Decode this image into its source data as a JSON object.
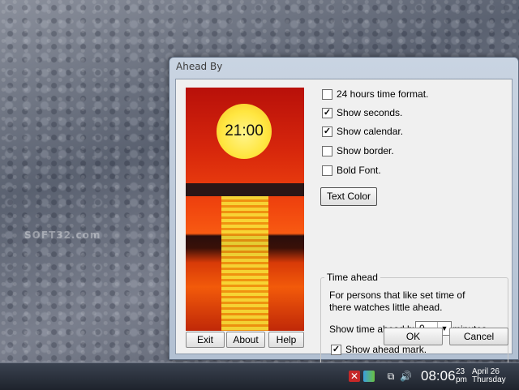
{
  "watermark": "SOFT32.com",
  "window": {
    "title": "Ahead By",
    "preview_time": "21:00",
    "options": [
      {
        "label": "24 hours time format.",
        "checked": false
      },
      {
        "label": "Show seconds.",
        "checked": true
      },
      {
        "label": "Show calendar.",
        "checked": true
      },
      {
        "label": "Show border.",
        "checked": false
      },
      {
        "label": "Bold Font.",
        "checked": false
      }
    ],
    "text_color_button": "Text Color",
    "time_ahead": {
      "group_title": "Time ahead",
      "description_line1": "For persons that like set time of",
      "description_line2": "there watches little ahead.",
      "show_label": "Show time ahead by",
      "value": "0",
      "unit": "minutes.",
      "ahead_mark_label": "Show ahead mark.",
      "ahead_mark_checked": true
    },
    "buttons": {
      "exit": "Exit",
      "about": "About",
      "help": "Help",
      "ok": "OK",
      "cancel": "Cancel"
    }
  },
  "taskbar": {
    "clock_time": "08:06",
    "clock_seconds": "23",
    "clock_ampm": "pm",
    "clock_date": "April 26",
    "clock_day": "Thursday"
  }
}
